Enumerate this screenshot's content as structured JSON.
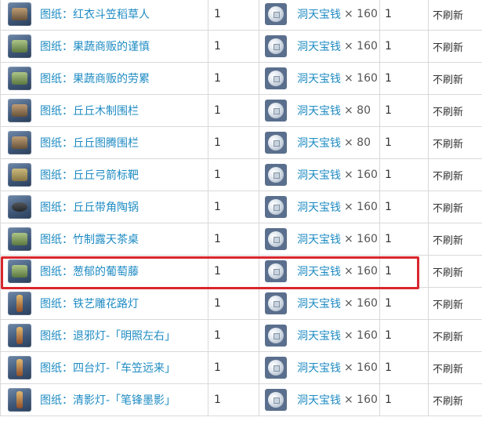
{
  "rows": [
    {
      "item": "图纸：红衣斗笠稻草人",
      "qty": "1",
      "currency": "洞天宝钱",
      "price": "× 160",
      "limit": "1",
      "refresh": "不刷新",
      "icon": "scarecrow-icon"
    },
    {
      "item": "图纸：果蔬商贩的谨慎",
      "qty": "1",
      "currency": "洞天宝钱",
      "price": "× 160",
      "limit": "1",
      "refresh": "不刷新",
      "icon": "vendor-stall-icon"
    },
    {
      "item": "图纸：果蔬商贩的劳累",
      "qty": "1",
      "currency": "洞天宝钱",
      "price": "× 160",
      "limit": "1",
      "refresh": "不刷新",
      "icon": "vendor-stall-icon"
    },
    {
      "item": "图纸：丘丘木制围栏",
      "qty": "1",
      "currency": "洞天宝钱",
      "price": "× 80",
      "limit": "1",
      "refresh": "不刷新",
      "icon": "wooden-fence-icon"
    },
    {
      "item": "图纸：丘丘图腾围栏",
      "qty": "1",
      "currency": "洞天宝钱",
      "price": "× 80",
      "limit": "1",
      "refresh": "不刷新",
      "icon": "totem-fence-icon"
    },
    {
      "item": "图纸：丘丘弓箭标靶",
      "qty": "1",
      "currency": "洞天宝钱",
      "price": "× 160",
      "limit": "1",
      "refresh": "不刷新",
      "icon": "archery-target-icon"
    },
    {
      "item": "图纸：丘丘带角陶锅",
      "qty": "1",
      "currency": "洞天宝钱",
      "price": "× 160",
      "limit": "1",
      "refresh": "不刷新",
      "icon": "clay-pot-icon"
    },
    {
      "item": "图纸：竹制露天茶桌",
      "qty": "1",
      "currency": "洞天宝钱",
      "price": "× 160",
      "limit": "1",
      "refresh": "不刷新",
      "icon": "tea-table-icon"
    },
    {
      "item": "图纸：葱郁的葡萄藤",
      "qty": "1",
      "currency": "洞天宝钱",
      "price": "× 160",
      "limit": "1",
      "refresh": "不刷新",
      "icon": "grape-vine-icon"
    },
    {
      "item": "图纸：铁艺雕花路灯",
      "qty": "1",
      "currency": "洞天宝钱",
      "price": "× 160",
      "limit": "1",
      "refresh": "不刷新",
      "icon": "street-lamp-icon"
    },
    {
      "item": "图纸：退邪灯-「明照左右」",
      "qty": "1",
      "currency": "洞天宝钱",
      "price": "× 160",
      "limit": "1",
      "refresh": "不刷新",
      "icon": "lantern-icon"
    },
    {
      "item": "图纸：四台灯-「车笠远来」",
      "qty": "1",
      "currency": "洞天宝钱",
      "price": "× 160",
      "limit": "1",
      "refresh": "不刷新",
      "icon": "lantern-icon"
    },
    {
      "item": "图纸：清影灯-「笔锋墨影」",
      "qty": "1",
      "currency": "洞天宝钱",
      "price": "× 160",
      "limit": "1",
      "refresh": "不刷新",
      "icon": "lantern-icon"
    }
  ],
  "coin_icon": "realm-currency-coin-icon",
  "colors": {
    "link": "#1e8bc3",
    "highlight": "#d9272e",
    "border": "#d9d9d9"
  }
}
